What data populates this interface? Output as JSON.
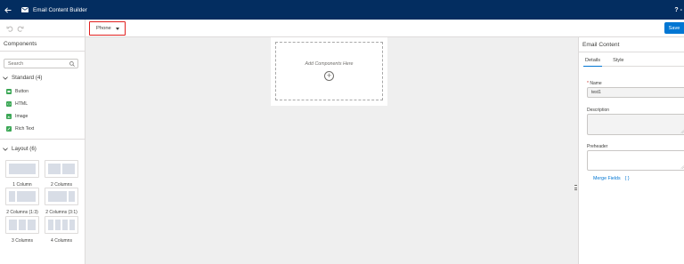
{
  "app": {
    "title": "Email Content Builder",
    "help_label": "?",
    "more_label": "-"
  },
  "toolbar": {
    "device": "Phone",
    "save_label": "Save"
  },
  "left_panel": {
    "title": "Components",
    "search_placeholder": "Search",
    "standard": {
      "label": "Standard (4)",
      "items": [
        {
          "label": "Button",
          "color": "#3ba755"
        },
        {
          "label": "HTML",
          "color": "#3ba755"
        },
        {
          "label": "Image",
          "color": "#3ba755"
        },
        {
          "label": "Rich Text",
          "color": "#3ba755"
        }
      ]
    },
    "layout": {
      "label": "Layout (6)",
      "items": [
        {
          "label": "1 Column"
        },
        {
          "label": "2 Columns"
        },
        {
          "label": "2 Columns (1:3)"
        },
        {
          "label": "2 Columns (3:1)"
        },
        {
          "label": "3 Columns"
        },
        {
          "label": "4 Columns"
        }
      ]
    }
  },
  "canvas": {
    "drop_hint": "Add Components Here",
    "add_symbol": "+"
  },
  "right_panel": {
    "title": "Email Content",
    "tabs": [
      {
        "label": "Details",
        "active": true
      },
      {
        "label": "Style",
        "active": false
      }
    ],
    "fields": {
      "name_required": "*",
      "name_label": "Name",
      "name_value": "test1",
      "description_label": "Description",
      "preheader_label": "Preheader"
    },
    "merge_fields_label": "Merge Fields",
    "merge_fields_icon": "{ }"
  },
  "colors": {
    "header_bg": "#032d60",
    "accent": "#0176d3",
    "highlight_border": "#e0201f",
    "component_icon": "#3ba755"
  }
}
